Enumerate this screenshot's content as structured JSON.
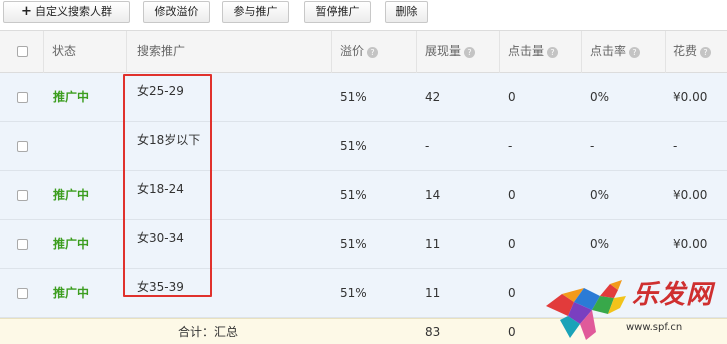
{
  "toolbar": {
    "add_label": "自定义搜索人群",
    "edit_price_label": "修改溢价",
    "join_label": "参与推广",
    "pause_label": "暂停推广",
    "delete_label": "删除"
  },
  "table": {
    "headers": {
      "status": "状态",
      "search_promo": "搜索推广",
      "premium": "溢价",
      "impressions": "展现量",
      "clicks": "点击量",
      "ctr": "点击率",
      "cost": "花费"
    },
    "rows": [
      {
        "status": "推广中",
        "name": "女25-29",
        "premium": "51%",
        "impressions": "42",
        "clicks": "0",
        "ctr": "0%",
        "cost": "¥0.00"
      },
      {
        "status": "",
        "name": "女18岁以下",
        "premium": "51%",
        "impressions": "-",
        "clicks": "-",
        "ctr": "-",
        "cost": "-"
      },
      {
        "status": "推广中",
        "name": "女18-24",
        "premium": "51%",
        "impressions": "14",
        "clicks": "0",
        "ctr": "0%",
        "cost": "¥0.00"
      },
      {
        "status": "推广中",
        "name": "女30-34",
        "premium": "51%",
        "impressions": "11",
        "clicks": "0",
        "ctr": "0%",
        "cost": "¥0.00"
      },
      {
        "status": "推广中",
        "name": "女35-39",
        "premium": "51%",
        "impressions": "11",
        "clicks": "0",
        "ctr": "",
        "cost": ""
      }
    ],
    "total": {
      "label": "合计：汇总",
      "impressions": "83",
      "clicks": "0"
    }
  },
  "watermark": {
    "text": "乐发网",
    "url": "www.spf.cn"
  },
  "colors": {
    "status_active": "#3c9d1f",
    "highlight": "#e0312c",
    "row_bg": "#eef4fb",
    "total_bg": "#fdf9e7"
  }
}
